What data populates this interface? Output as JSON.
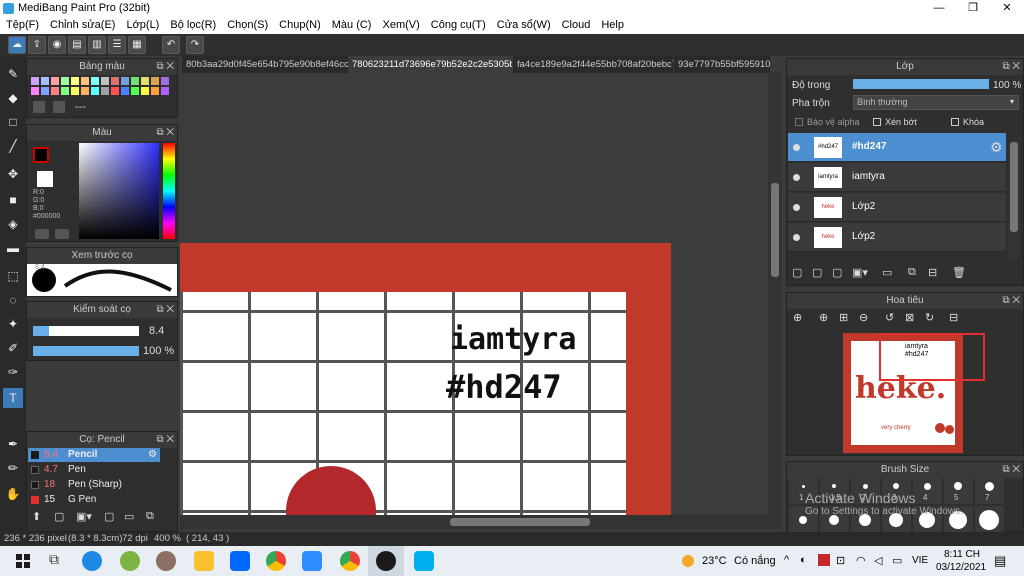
{
  "window": {
    "title": "MediBang Paint Pro (32bit)",
    "controls": [
      "—",
      "❐",
      "✕"
    ]
  },
  "menu": [
    "Tệp(F)",
    "Chỉnh sửa(E)",
    "Lớp(L)",
    "Bộ lọc(R)",
    "Chọn(S)",
    "Chụp(N)",
    "Màu (C)",
    "Xem(V)",
    "Công cụ(T)",
    "Cửa sổ(W)",
    "Cloud",
    "Help"
  ],
  "tabs": [
    {
      "label": "80b3aa29d0f45e654b795e90b8ef46cc.jpg"
    },
    {
      "label": "780623211d73696e79b52e2c2e5305bc.jpg"
    },
    {
      "label": "fa4ce189e9a2f44e55bb708af20bebc7.jpg"
    },
    {
      "label": "93e7797b55bf5959101"
    }
  ],
  "panels": {
    "palette": {
      "title": "Bảng màu",
      "extra": "---"
    },
    "color": {
      "title": "Màu",
      "r": "R:0",
      "g": "G:0",
      "b": "B:0",
      "hex": "#000000"
    },
    "preview": {
      "title": "Xem trước cọ",
      "size": "8.4"
    },
    "control": {
      "title": "Kiểm soát cọ",
      "size": "8.4",
      "opacity": "100 %"
    },
    "brush": {
      "title": "Cọ: Pencil",
      "items": [
        {
          "size": "8.4",
          "name": "Pencil",
          "color": "#1a1a1a"
        },
        {
          "size": "4.7",
          "name": "Pen",
          "color": "#1a1a1a"
        },
        {
          "size": "18",
          "name": "Pen (Sharp)",
          "color": "#1a1a1a"
        },
        {
          "size": "15",
          "name": "G Pen",
          "color": "#e03030"
        }
      ]
    },
    "layer": {
      "title": "Lớp",
      "opacity_label": "Độ trong",
      "opacity_value": "100 %",
      "blend_label": "Pha trộn",
      "blend_value": "Bình thường",
      "protect_alpha": "Bảo vệ alpha",
      "clipping": "Xén bớt",
      "lock": "Khóa",
      "rows": [
        {
          "name": "#hd247",
          "thumb": "#hd247"
        },
        {
          "name": "iamtyra",
          "thumb": "iamtyra"
        },
        {
          "name": "Lớp2",
          "thumb": "heke"
        },
        {
          "name": "Lớp2",
          "thumb": "heke"
        }
      ]
    },
    "navigator": {
      "title": "Hoa tiêu",
      "thumb_text1": "iamtyra",
      "thumb_text2": "#hd247",
      "thumb_text3": "heke.",
      "thumb_text4": "very cherry"
    },
    "brushsize": {
      "title": "Brush Size",
      "sizes": [
        "1",
        "1.5",
        "2",
        "3",
        "4",
        "5",
        "7"
      ],
      "activate1": "Activate Windows",
      "activate2": "Go to Settings to activate Windows."
    }
  },
  "canvas": {
    "text1": "iamtyra",
    "text2": "#hd247"
  },
  "status": {
    "size": "236 * 236 pixel",
    "cm": "(8.3 * 8.3cm)",
    "dpi": "72 dpi",
    "zoom": "400 %",
    "coord": "( 214, 43 )"
  },
  "taskbar": {
    "weather_temp": "23°C",
    "weather_text": "Có nắng",
    "lang": "VIE",
    "time": "8:11 CH",
    "date": "03/12/2021"
  },
  "colors": {
    "accent": "#4c8ed0",
    "red": "#c0392b"
  }
}
